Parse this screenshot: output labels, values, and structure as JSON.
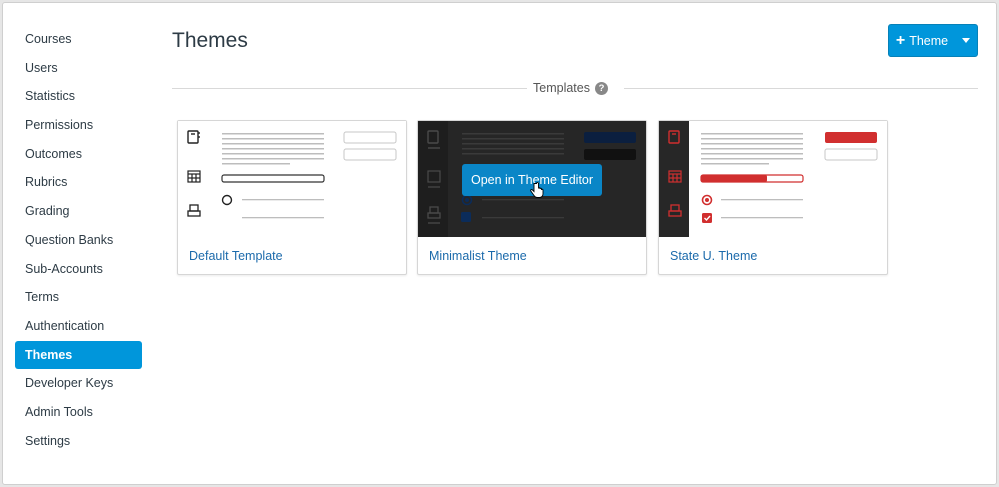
{
  "sidebar": {
    "items": [
      {
        "label": "Courses",
        "active": false
      },
      {
        "label": "Users",
        "active": false
      },
      {
        "label": "Statistics",
        "active": false
      },
      {
        "label": "Permissions",
        "active": false
      },
      {
        "label": "Outcomes",
        "active": false
      },
      {
        "label": "Rubrics",
        "active": false
      },
      {
        "label": "Grading",
        "active": false
      },
      {
        "label": "Question Banks",
        "active": false
      },
      {
        "label": "Sub-Accounts",
        "active": false
      },
      {
        "label": "Terms",
        "active": false
      },
      {
        "label": "Authentication",
        "active": false
      },
      {
        "label": "Themes",
        "active": true
      },
      {
        "label": "Developer Keys",
        "active": false
      },
      {
        "label": "Admin Tools",
        "active": false
      },
      {
        "label": "Settings",
        "active": false
      }
    ]
  },
  "header": {
    "title": "Themes",
    "add_button_label": "Theme",
    "add_button_icon": "plus-icon"
  },
  "templates_section": {
    "label": "Templates",
    "help_glyph": "?"
  },
  "cards": [
    {
      "name": "Default Template",
      "style": "default"
    },
    {
      "name": "Minimalist Theme",
      "style": "minimalist",
      "hover_button_label": "Open in Theme Editor"
    },
    {
      "name": "State U. Theme",
      "style": "stateu"
    }
  ],
  "colors": {
    "brand": "#0096db",
    "link": "#1b6aab",
    "stateu_red": "#d12f2f",
    "minimalist_dark": "#272727",
    "minimalist_navy": "#0b1f3f"
  }
}
